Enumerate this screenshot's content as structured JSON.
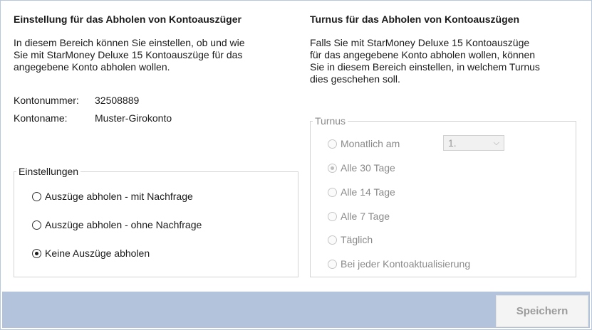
{
  "left": {
    "title": "Einstellung für das Abholen von Kontoauszüger",
    "description_lines": [
      "In diesem Bereich können Sie einstellen, ob und wie",
      "Sie mit StarMoney Deluxe 15 Kontoauszüge für das",
      "angegebene Konto abholen wollen."
    ],
    "account_number_label": "Kontonummer:",
    "account_number_value": "32508889",
    "account_name_label": "Kontoname:",
    "account_name_value": "Muster-Girokonto",
    "settings_group": {
      "legend": "Einstellungen",
      "options": [
        {
          "label": "Auszüge abholen - mit Nachfrage",
          "checked": false
        },
        {
          "label": "Auszüge abholen - ohne Nachfrage",
          "checked": false
        },
        {
          "label": "Keine Auszüge abholen",
          "checked": true
        }
      ]
    }
  },
  "right": {
    "title": "Turnus für das Abholen von Kontoauszügen",
    "description_lines": [
      "Falls Sie mit StarMoney Deluxe 15 Kontoauszüge",
      "für das angegebene Konto abholen wollen, können",
      "Sie in diesem Bereich einstellen, in welchem Turnus",
      "dies geschehen soll."
    ],
    "turnus_group": {
      "legend": "Turnus",
      "enabled": false,
      "monthly_day_value": "1.",
      "options": [
        {
          "label": "Monatlich am",
          "checked": false
        },
        {
          "label": "Alle 30 Tage",
          "checked": true
        },
        {
          "label": "Alle 14 Tage",
          "checked": false
        },
        {
          "label": "Alle 7 Tage",
          "checked": false
        },
        {
          "label": "Täglich",
          "checked": false
        },
        {
          "label": "Bei jeder Kontoaktualisierung",
          "checked": false
        }
      ]
    }
  },
  "footer": {
    "save_label": "Speichern",
    "save_enabled": false,
    "color": "#b2c3db"
  }
}
